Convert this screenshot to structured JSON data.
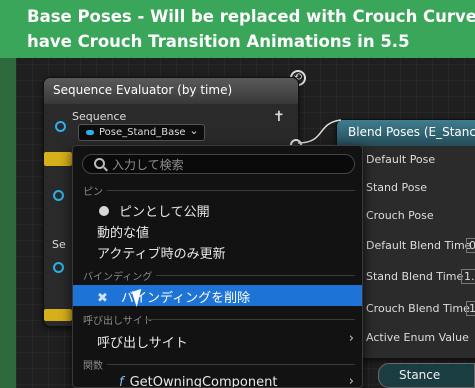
{
  "comment": {
    "line1": "Base Poses - Will be replaced with Crouch Curve",
    "line2": "have Crouch Transition Animations in 5.5"
  },
  "sequence_evaluator": {
    "title": "Sequence Evaluator (by time)",
    "sequence_label": "Sequence",
    "sequence_value": "Pose_Stand_Base",
    "partial_label": "Se"
  },
  "blend_node": {
    "title": "Blend Poses (E_Stance)",
    "pins": [
      "Default Pose",
      "Stand Pose",
      "Crouch Pose",
      "Default Blend Time",
      "Stand Blend Time",
      "Crouch Blend Time",
      "Active Enum Value"
    ],
    "values": [
      "0",
      "1.",
      "1"
    ]
  },
  "stance_label": "Stance",
  "menu": {
    "search_placeholder": "入力して検索",
    "section_pin": "ピン",
    "item_expose_pin": "ピンとして公開",
    "item_dynamic": "動的な値",
    "item_update_active": "アクティブ時のみ更新",
    "section_binding": "バインディング",
    "item_remove_binding": "バインディングを削除",
    "section_callsite": "呼び出しサイト",
    "item_callsite": "呼び出しサイト",
    "section_function": "関数",
    "item_get_owning": "GetOwningComponent"
  },
  "colors": {
    "comment": "#3aa65a",
    "highlight": "#1e74d6",
    "pin": "#2bb0e8"
  }
}
